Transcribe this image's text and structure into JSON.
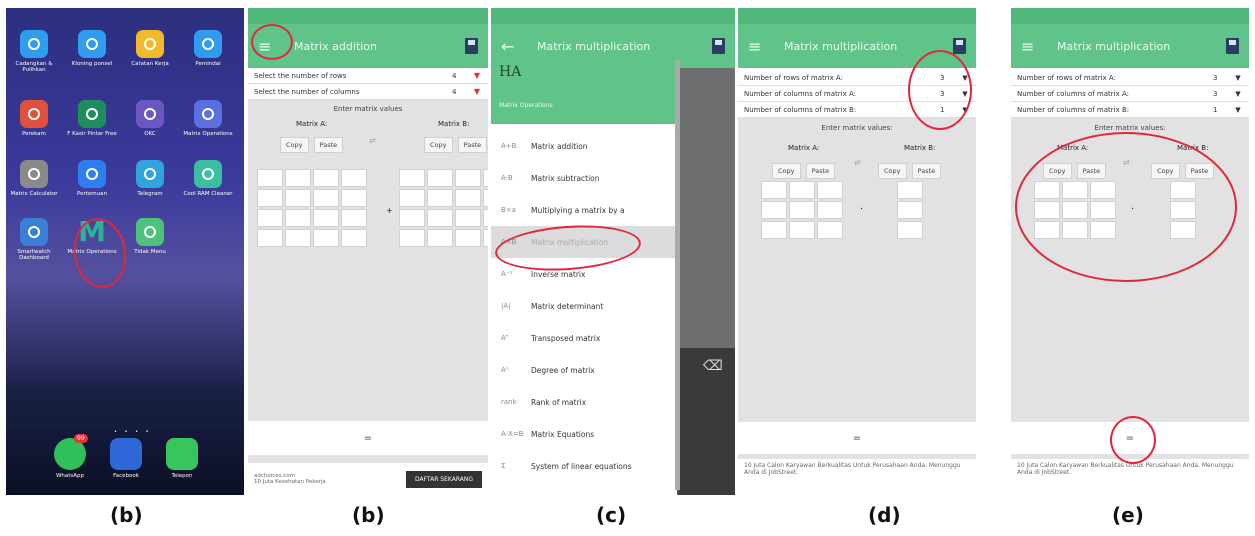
{
  "captions": [
    "(b)",
    "(b)",
    "(c)",
    "(d)",
    "(e)"
  ],
  "home": {
    "apps": [
      {
        "label": "Cadangkan & Pulihkan",
        "color": "#2f9cf0",
        "icon": "sync-icon"
      },
      {
        "label": "Kloning ponsel",
        "color": "#2f9cf0",
        "icon": "sync-icon"
      },
      {
        "label": "Catatan Kerja",
        "color": "#f2b92d",
        "icon": "bulb-icon"
      },
      {
        "label": "Pemindai",
        "color": "#2f9cf0",
        "icon": "circle-icon"
      },
      {
        "label": "Perekam",
        "color": "#e0503a",
        "icon": "record-icon"
      },
      {
        "label": "F Kasir Pintar Free",
        "color": "#1e8e5e",
        "icon": "shop-icon"
      },
      {
        "label": "OKC",
        "color": "#6b57c4",
        "icon": "ring-icon"
      },
      {
        "label": "Matrix Operations",
        "color": "#5a6fe0",
        "icon": "matrix-icon"
      },
      {
        "label": "Matrix Calculator",
        "color": "#8a8a8a",
        "icon": "calc-icon"
      },
      {
        "label": "Pertemuan",
        "color": "#2f7ef0",
        "icon": "video-icon"
      },
      {
        "label": "Telegram",
        "color": "#32a3df",
        "icon": "plane-icon"
      },
      {
        "label": "Cool RAM Cleaner",
        "color": "#3cbfa0",
        "icon": "map-icon"
      },
      {
        "label": "Smartwatch Dashboard",
        "color": "#3b7fd6",
        "icon": "gear-icon"
      },
      {
        "label": "Matrix Operations",
        "color": "transparent",
        "icon": "m-icon"
      },
      {
        "label": "Tidak Menu",
        "color": "#4cc27a",
        "icon": "doc-icon"
      }
    ],
    "dock": [
      {
        "label": "WhatsApp",
        "color": "#2fc05a",
        "icon": "whatsapp-icon",
        "badge": "99"
      },
      {
        "label": "Facebook",
        "color": "#2f66d8",
        "icon": "facebook-icon"
      },
      {
        "label": "Telepon",
        "color": "#3ac45e",
        "icon": "phone-icon"
      }
    ],
    "m_letter": "M"
  },
  "addition": {
    "title": "Matrix addition",
    "rows": [
      {
        "label": "Select the number of rows",
        "value": "4"
      },
      {
        "label": "Select the number of columns",
        "value": "4"
      }
    ],
    "enter": "Enter matrix values",
    "matrix_a": "Matrix A:",
    "matrix_b": "Matrix B:",
    "copy": "Copy",
    "paste": "Paste",
    "plus": "+",
    "bottom": "=",
    "ad_text": "adchoices.com\n10 Juta Kesehatan Pekerja",
    "ad_button": "DAFTAR SEKARANG"
  },
  "drawer": {
    "title": "Matrix multiplication",
    "header_logo": "HA",
    "header_sub": "Matrix Operations",
    "items": [
      {
        "label": "Matrix addition",
        "icon": "A+B"
      },
      {
        "label": "Matrix subtraction",
        "icon": "A-B"
      },
      {
        "label": "Multiplying a matrix by a",
        "icon": "B×a"
      },
      {
        "label": "Matrix multiplication",
        "icon": "A×B"
      },
      {
        "label": "Inverse matrix",
        "icon": "A⁻¹"
      },
      {
        "label": "Matrix determinant",
        "icon": "|A|"
      },
      {
        "label": "Transposed matrix",
        "icon": "Aᵀ"
      },
      {
        "label": "Degree of matrix",
        "icon": "Aⁿ"
      },
      {
        "label": "Rank of matrix",
        "icon": "rank"
      },
      {
        "label": "Matrix Equations",
        "icon": "A·X=B"
      },
      {
        "label": "System of linear equations",
        "icon": "Σ"
      }
    ],
    "backspace": "⌫"
  },
  "mult_d": {
    "title": "Matrix multiplication",
    "rows": [
      {
        "label": "Number of rows of matrix A:",
        "value": "3"
      },
      {
        "label": "Number of columns of matrix A:",
        "value": "3"
      },
      {
        "label": "Number of columns of matrix B:",
        "value": "1"
      }
    ],
    "enter": "Enter matrix values:",
    "matrix_a": "Matrix A:",
    "matrix_b": "Matrix B:",
    "copy": "Copy",
    "paste": "Paste",
    "dot": "·",
    "bottom": "=",
    "ad_text": "10 Juta Calon Karyawan Berkualitas Untuk Perusahaan Anda. Menunggu Anda di JobStreet."
  },
  "mult_e": {
    "title": "Matrix multiplication",
    "rows": [
      {
        "label": "Number of rows of matrix A:",
        "value": "3"
      },
      {
        "label": "Number of columns of matrix A:",
        "value": "3"
      },
      {
        "label": "Number of columns of matrix B:",
        "value": "1"
      }
    ],
    "enter": "Enter matrix values:",
    "matrix_a": "Matrix A:",
    "matrix_b": "Matrix B:",
    "copy": "Copy",
    "paste": "Paste",
    "dot": "·",
    "bottom": "=",
    "ad_text": "10 Juta Calon Karyawan Berkualitas Untuk Perusahaan Anda. Menunggu Anda di JobStreet."
  }
}
